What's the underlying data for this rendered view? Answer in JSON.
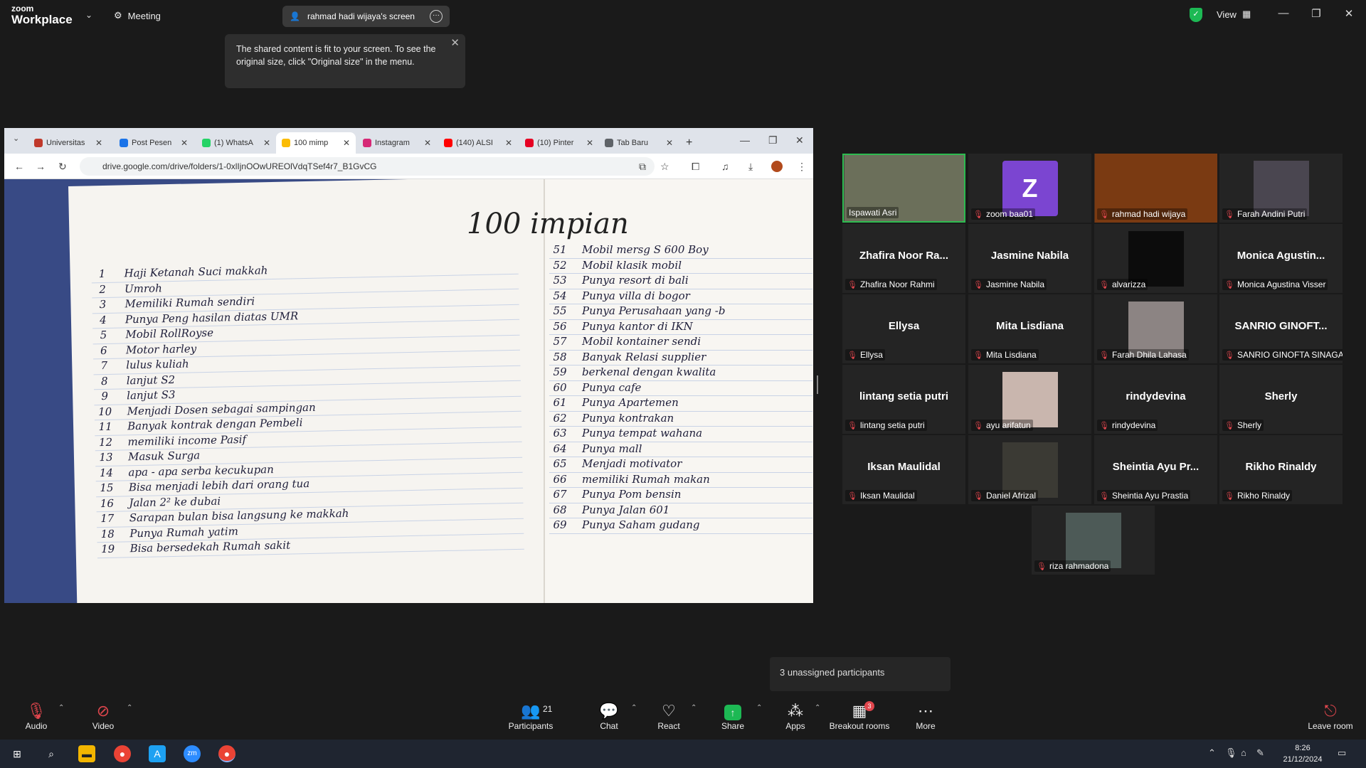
{
  "app": {
    "logo_top": "zoom",
    "logo_bottom": "Workplace",
    "meeting_label": "Meeting",
    "screen_label": "rahmad hadi wijaya's screen",
    "view_label": "View"
  },
  "tooltip": {
    "text": "The shared content is fit to your screen. To see the original size, click \"Original size\" in the menu."
  },
  "browser": {
    "tabs": [
      {
        "label": "Universitas",
        "color": "#c0392b"
      },
      {
        "label": "Post Pesen",
        "color": "#1a73e8"
      },
      {
        "label": "(1) WhatsA",
        "color": "#25d366"
      },
      {
        "label": "100 mimp",
        "color": "#fbbc04"
      },
      {
        "label": "Instagram",
        "color": "#d62976"
      },
      {
        "label": "(140) ALSI",
        "color": "#ff0000"
      },
      {
        "label": "(10) Pinter",
        "color": "#e60023"
      },
      {
        "label": "Tab Baru",
        "color": "#5f6368"
      }
    ],
    "url": "drive.google.com/drive/folders/1-0xlIjnOOwUREOlVdqTSef4r7_B1GvCG"
  },
  "notebook": {
    "title": "100 impian",
    "left_items": [
      {
        "n": "1",
        "t": "Haji Ketanah Suci makkah"
      },
      {
        "n": "2",
        "t": "Umroh"
      },
      {
        "n": "3",
        "t": "Memiliki Rumah sendiri"
      },
      {
        "n": "4",
        "t": "Punya Peng hasilan diatas UMR"
      },
      {
        "n": "5",
        "t": "Mobil RollRoyse"
      },
      {
        "n": "6",
        "t": "Motor harley"
      },
      {
        "n": "7",
        "t": "lulus kuliah"
      },
      {
        "n": "8",
        "t": "lanjut S2"
      },
      {
        "n": "9",
        "t": "lanjut S3"
      },
      {
        "n": "10",
        "t": "Menjadi Dosen sebagai sampingan"
      },
      {
        "n": "11",
        "t": "Banyak kontrak dengan Pembeli"
      },
      {
        "n": "12",
        "t": "memiliki income Pasif"
      },
      {
        "n": "13",
        "t": "Masuk Surga"
      },
      {
        "n": "14",
        "t": "apa - apa serba kecukupan"
      },
      {
        "n": "15",
        "t": "Bisa menjadi lebih dari orang tua"
      },
      {
        "n": "16",
        "t": "Jalan 2² ke dubai"
      },
      {
        "n": "17",
        "t": "Sarapan bulan bisa langsung ke makkah"
      },
      {
        "n": "18",
        "t": "Punya Rumah yatim"
      },
      {
        "n": "19",
        "t": "Bisa bersedekah Rumah sakit"
      }
    ],
    "right_items": [
      {
        "n": "51",
        "t": "Mobil mersg S 600 Boy"
      },
      {
        "n": "52",
        "t": "Mobil klasik mobil"
      },
      {
        "n": "53",
        "t": "Punya resort di bali"
      },
      {
        "n": "54",
        "t": "Punya villa di bogor"
      },
      {
        "n": "55",
        "t": "Punya Perusahaan yang -b"
      },
      {
        "n": "56",
        "t": "Punya kantor di IKN"
      },
      {
        "n": "57",
        "t": "Mobil kontainer sendi"
      },
      {
        "n": "58",
        "t": "Banyak Relasi supplier"
      },
      {
        "n": "59",
        "t": "berkenal dengan kwalita"
      },
      {
        "n": "60",
        "t": "Punya cafe"
      },
      {
        "n": "61",
        "t": "Punya Apartemen"
      },
      {
        "n": "62",
        "t": "Punya kontrakan"
      },
      {
        "n": "63",
        "t": "Punya tempat wahana"
      },
      {
        "n": "64",
        "t": "Punya mall"
      },
      {
        "n": "65",
        "t": "Menjadi motivator"
      },
      {
        "n": "66",
        "t": "memiliki Rumah makan"
      },
      {
        "n": "67",
        "t": "Punya Pom bensin"
      },
      {
        "n": "68",
        "t": "Punya Jalan 601"
      },
      {
        "n": "69",
        "t": "Punya Saham gudang"
      }
    ]
  },
  "participants": [
    {
      "label": "Ispawati Asri",
      "big": "",
      "kind": "video",
      "color": "#6b6f5a",
      "active": true
    },
    {
      "label": "zoom baa01",
      "big": "",
      "kind": "avatar",
      "avatar": "Z"
    },
    {
      "label": "rahmad hadi wijaya",
      "big": "",
      "kind": "video",
      "color": "#7a3a12"
    },
    {
      "label": "Farah Andini Putri",
      "big": "",
      "kind": "video",
      "color": "#4a4650"
    },
    {
      "label": "Zhafira Noor Rahmi",
      "big": "Zhafira Noor Ra...",
      "kind": "name"
    },
    {
      "label": "Jasmine Nabila",
      "big": "Jasmine Nabila",
      "kind": "name"
    },
    {
      "label": "alvarizza",
      "big": "",
      "kind": "video",
      "color": "#0c0c0c"
    },
    {
      "label": "Monica Agustina Visser",
      "big": "Monica  Agustin...",
      "kind": "name"
    },
    {
      "label": "Ellysa",
      "big": "Ellysa",
      "kind": "name"
    },
    {
      "label": "Mita Lisdiana",
      "big": "Mita Lisdiana",
      "kind": "name"
    },
    {
      "label": "Farah Dhila Lahasa",
      "big": "",
      "kind": "video",
      "color": "#8c8483"
    },
    {
      "label": "SANRIO GINOFTA SINAGA",
      "big": "SANRIO GINOFT...",
      "kind": "name"
    },
    {
      "label": "lintang setia putri",
      "big": "lintang setia putri",
      "kind": "name"
    },
    {
      "label": "ayu arifatun",
      "big": "",
      "kind": "video",
      "color": "#c9b6ae"
    },
    {
      "label": "rindydevina",
      "big": "rindydevina",
      "kind": "name"
    },
    {
      "label": "Sherly",
      "big": "Sherly",
      "kind": "name"
    },
    {
      "label": "Iksan Maulidal",
      "big": "Iksan Maulidal",
      "kind": "name"
    },
    {
      "label": "Daniel Afrizal",
      "big": "",
      "kind": "video",
      "color": "#3b3a34"
    },
    {
      "label": "Sheintia Ayu Prastia",
      "big": "Sheintia Ayu Pr...",
      "kind": "name"
    },
    {
      "label": "Rikho Rinaldy",
      "big": "Rikho Rinaldy",
      "kind": "name"
    },
    {
      "label": "riza rahmadona",
      "big": "",
      "kind": "video",
      "color": "#4d5a57"
    }
  ],
  "unassigned": "3 unassigned participants",
  "toolbar": {
    "audio": "Audio",
    "video": "Video",
    "participants": "Participants",
    "participants_count": "21",
    "chat": "Chat",
    "react": "React",
    "share": "Share",
    "apps": "Apps",
    "breakout": "Breakout rooms",
    "breakout_badge": "3",
    "more": "More",
    "leave": "Leave room"
  },
  "taskbar": {
    "time": "8:26",
    "date": "21/12/2024"
  }
}
